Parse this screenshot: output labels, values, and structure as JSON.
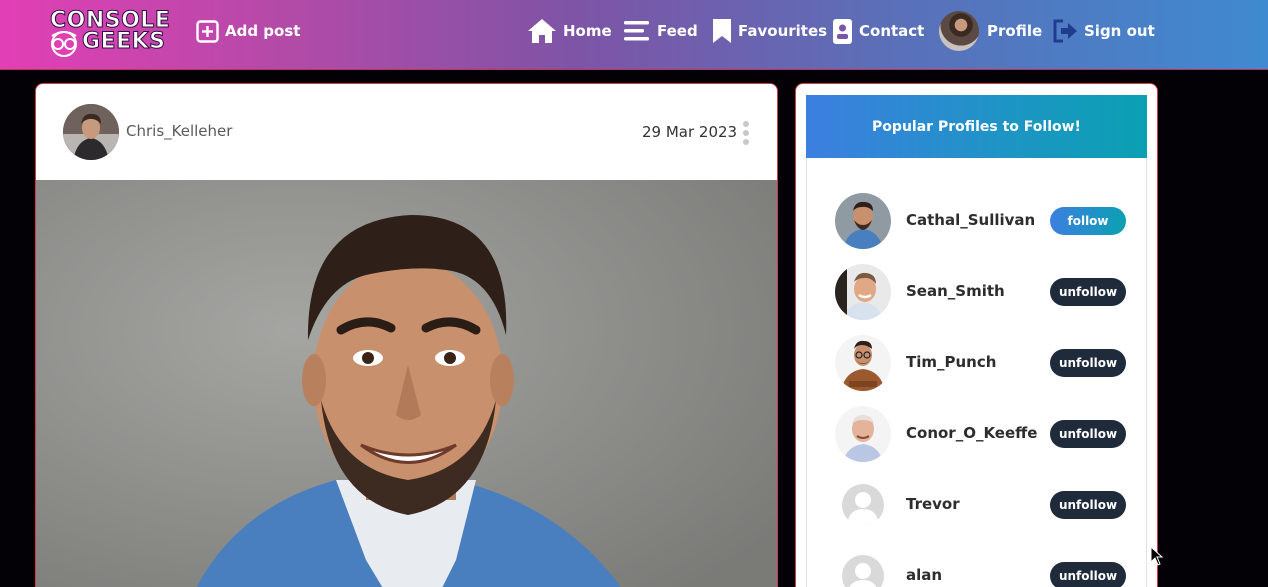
{
  "navbar": {
    "logo_line1": "CONSOLE",
    "logo_line2": "GEEKS",
    "add_post": "Add post",
    "home": "Home",
    "feed": "Feed",
    "favourites": "Favourites",
    "contact": "Contact",
    "profile": "Profile",
    "sign_out": "Sign out",
    "icons": [
      "plus-square-icon",
      "home-icon",
      "feed-lines-icon",
      "bookmark-icon",
      "contact-card-icon",
      "sign-out-icon"
    ]
  },
  "post": {
    "author": "Chris_Kelleher",
    "date": "29 Mar 2023",
    "menu_icon": "vertical-dots-icon"
  },
  "sidebar": {
    "title": "Popular Profiles to Follow!",
    "profiles": [
      {
        "name": "Cathal_Sullivan",
        "button": "follow"
      },
      {
        "name": "Sean_Smith",
        "button": "unfollow"
      },
      {
        "name": "Tim_Punch",
        "button": "unfollow"
      },
      {
        "name": "Conor_O_Keeffe",
        "button": "unfollow"
      },
      {
        "name": "Trevor",
        "button": "unfollow"
      },
      {
        "name": "alan",
        "button": "unfollow"
      }
    ]
  },
  "colors": {
    "navbar_start": "#e23fb5",
    "navbar_end": "#3f8ad0",
    "accent_follow": "#3d7fe0",
    "unfollow_button": "#1f2a3a",
    "card_border": "#d23a4a",
    "page_background": "#030006"
  }
}
